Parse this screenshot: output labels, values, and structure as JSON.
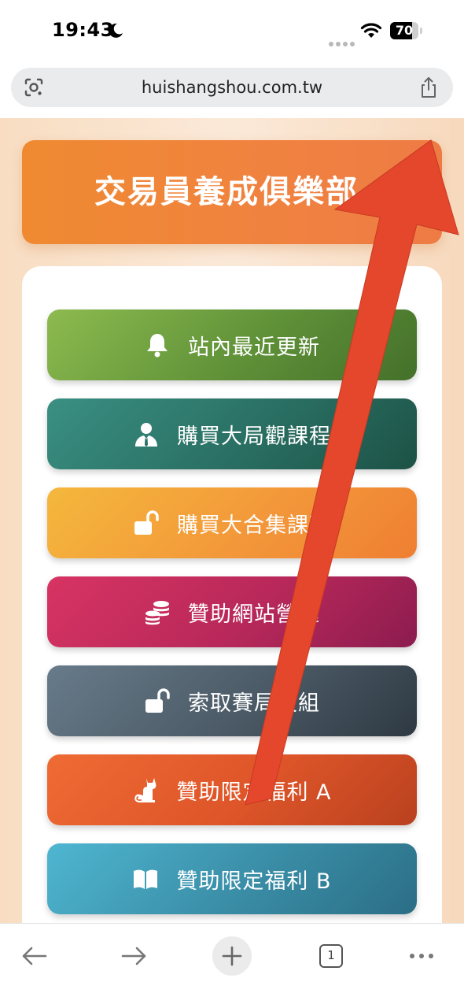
{
  "status_bar": {
    "time": "19:43",
    "battery_level": "70",
    "icons": [
      "moon-icon",
      "signal-dots-icon",
      "wifi-icon",
      "battery-icon"
    ]
  },
  "address_bar": {
    "url": "huishangshou.com.tw",
    "icons": [
      "lens-icon",
      "share-icon"
    ]
  },
  "page": {
    "header_title": "交易員養成俱樂部",
    "menu": [
      {
        "label": "站內最近更新",
        "icon": "bell-icon",
        "color": "#5f9138"
      },
      {
        "label": "購買大局觀課程",
        "icon": "user-tie-icon",
        "color": "#2a6f63"
      },
      {
        "label": "購買大合集課程",
        "icon": "unlock-icon",
        "color": "#f3983a"
      },
      {
        "label": "贊助網站營運",
        "icon": "coins-icon",
        "color": "#b8285a"
      },
      {
        "label": "索取賽局設組",
        "icon": "unlock-icon",
        "color": "#4b5a66"
      },
      {
        "label": "贊助限定福利 A",
        "icon": "cat-icon",
        "color": "#de5529"
      },
      {
        "label": "贊助限定福利 B",
        "icon": "book-open-icon",
        "color": "#3a8da6"
      }
    ]
  },
  "overlay": {
    "arrow_color": "#e4472b",
    "arrow_icon": "red-arrow-annotation"
  },
  "toolbar": {
    "tab_count": "1",
    "icons": [
      "back-arrow-icon",
      "forward-arrow-icon",
      "plus-icon",
      "tabs-icon",
      "more-icon"
    ]
  }
}
